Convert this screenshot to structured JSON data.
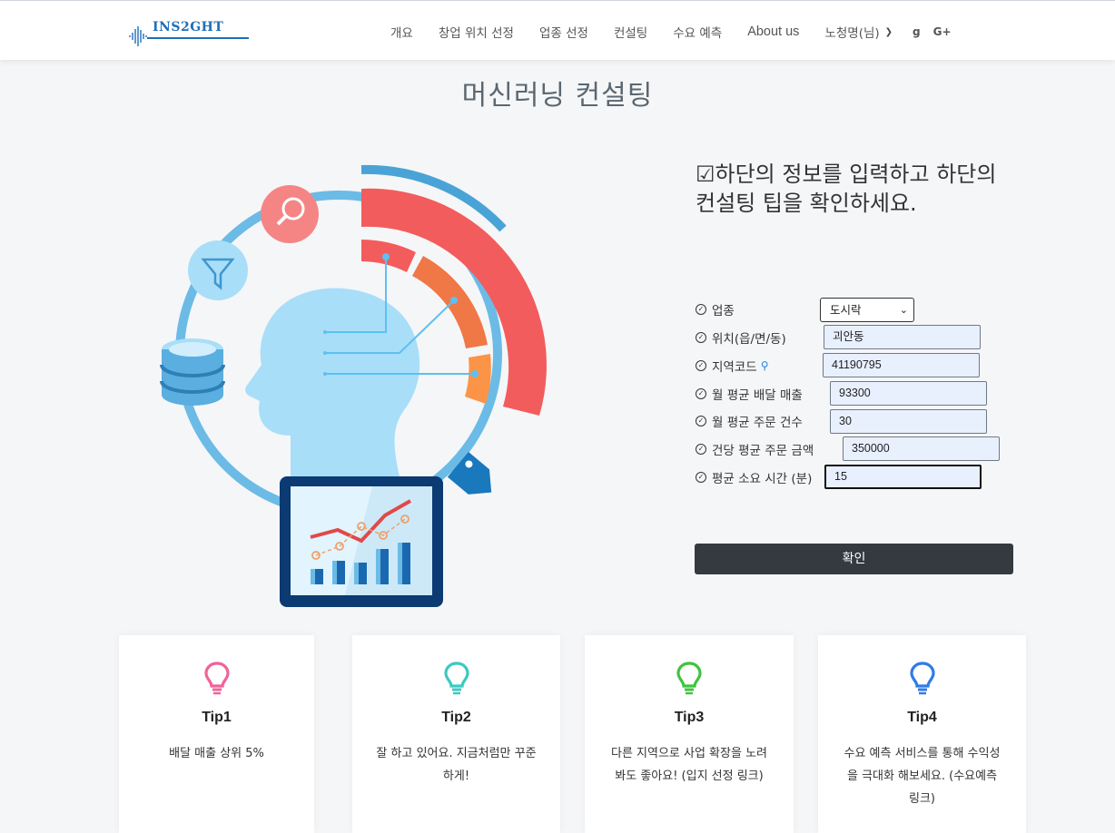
{
  "nav": {
    "logo": "INS2GHT",
    "items": [
      "개요",
      "창업 위치 선정",
      "업종 선정",
      "컨설팅",
      "수요 예측",
      "About us"
    ],
    "user": "노청명(님)",
    "social": [
      "g",
      "G+"
    ]
  },
  "page_title": "머신러닝 컨설팅",
  "instruction": "☑하단의 정보를 입력하고 하단의 컨설팅 팁을 확인하세요.",
  "form": {
    "business_type": {
      "label": "업종",
      "value": "도시락"
    },
    "location": {
      "label": "위치(읍/면/동)",
      "value": "괴안동"
    },
    "area_code": {
      "label": "지역코드",
      "value": "41190795"
    },
    "monthly_sales": {
      "label": "월 평균 배달 매출",
      "value": "93300"
    },
    "monthly_orders": {
      "label": "월 평균 주문 건수",
      "value": "30"
    },
    "avg_order_amount": {
      "label": "건당 평균 주문 금액",
      "value": "350000"
    },
    "avg_time": {
      "label": "평균 소요 시간 (분)",
      "value": "15"
    },
    "submit": "확인"
  },
  "tips": [
    {
      "title": "Tip1",
      "text": "배달 매출 상위 5%",
      "color": "#f0629a"
    },
    {
      "title": "Tip2",
      "text": "잘 하고 있어요. 지금처럼만 꾸준하게!",
      "color": "#3cc9c0"
    },
    {
      "title": "Tip3",
      "text": "다른 지역으로 사업 확장을 노려봐도 좋아요! (입지 선정 링크)",
      "color": "#3fc43f"
    },
    {
      "title": "Tip4",
      "text": "수요 예측 서비스를 통해 수익성을 극대화 해보세요. (수요예측링크)",
      "color": "#2f7be8"
    }
  ]
}
